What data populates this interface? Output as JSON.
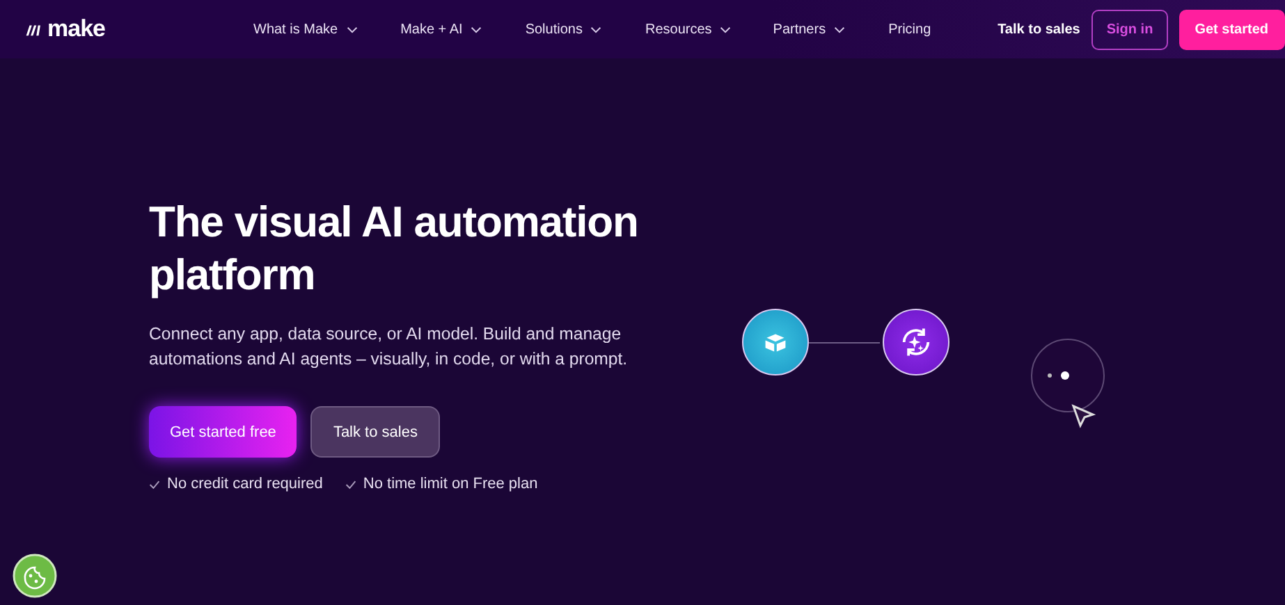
{
  "header": {
    "logo": "make",
    "nav": [
      {
        "label": "What is Make",
        "dropdown": true
      },
      {
        "label": "Make + AI",
        "dropdown": true
      },
      {
        "label": "Solutions",
        "dropdown": true
      },
      {
        "label": "Resources",
        "dropdown": true
      },
      {
        "label": "Partners",
        "dropdown": true
      },
      {
        "label": "Pricing",
        "dropdown": false
      }
    ],
    "actions": [
      {
        "label": "Talk to sales",
        "kind": "link"
      },
      {
        "label": "Sign in",
        "kind": "outline"
      },
      {
        "label": "Get started",
        "kind": "primary"
      }
    ]
  },
  "hero": {
    "title": "The visual AI automation platform",
    "subtitle": "Connect any app, data source, or AI model. Build and manage automations and AI agents – visually, in code, or with a prompt.",
    "buttons": [
      {
        "label": "Get started free",
        "kind": "primary"
      },
      {
        "label": "Talk to sales",
        "kind": "secondary"
      }
    ],
    "benefits": [
      "No credit card required",
      "No time limit on Free plan"
    ]
  }
}
